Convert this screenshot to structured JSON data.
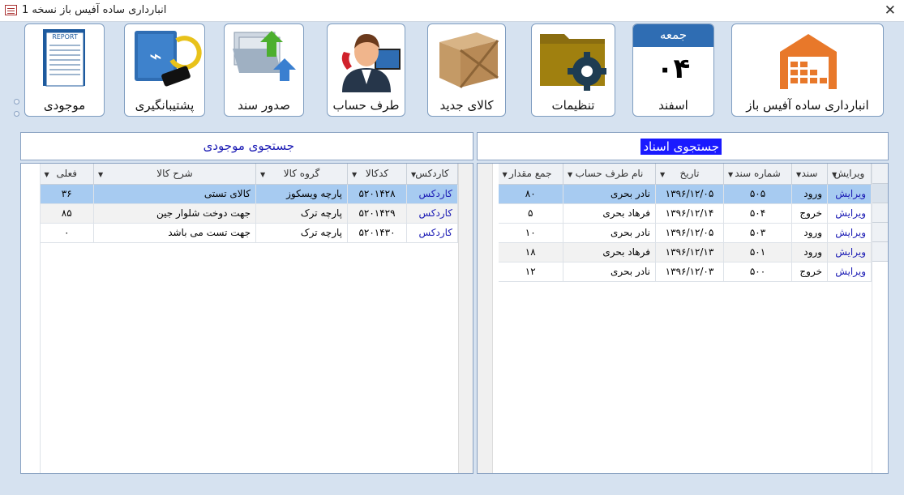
{
  "window": {
    "title": "انبارداری ساده آفیس باز  نسخه 1",
    "close_label": "✕"
  },
  "ribbon": {
    "main_label": "انبارداری ساده آفیس باز",
    "date": {
      "day_name": "جمعه",
      "day": "۰۴",
      "month": "اسفند"
    },
    "settings_label": "تنظیمات",
    "new_item_label": "کالای جدید",
    "account_label": "طرف حساب",
    "issue_doc_label": "صدور سند",
    "backup_label": "پشتیبانگیری",
    "inventory_label": "موجودی",
    "report_icon_text": "REPORT"
  },
  "docs_panel": {
    "title": "جستجوی اسناد",
    "columns": [
      "ویرایش",
      "سند",
      "شماره سند",
      "تاریخ",
      "نام طرف حساب",
      "جمع مقدار"
    ],
    "rows": [
      {
        "edit": "ویرایش",
        "type": "ورود",
        "number": "۵۰۵",
        "date": "۱۳۹۶/۱۲/۰۵",
        "party": "نادر بحری",
        "total": "۸۰"
      },
      {
        "edit": "ویرایش",
        "type": "خروج",
        "number": "۵۰۴",
        "date": "۱۳۹۶/۱۲/۱۴",
        "party": "فرهاد بحری",
        "total": "۵"
      },
      {
        "edit": "ویرایش",
        "type": "ورود",
        "number": "۵۰۳",
        "date": "۱۳۹۶/۱۲/۰۵",
        "party": "نادر بحری",
        "total": "۱۰"
      },
      {
        "edit": "ویرایش",
        "type": "ورود",
        "number": "۵۰۱",
        "date": "۱۳۹۶/۱۲/۱۳",
        "party": "فرهاد بحری",
        "total": "۱۸"
      },
      {
        "edit": "ویرایش",
        "type": "خروج",
        "number": "۵۰۰",
        "date": "۱۳۹۶/۱۲/۰۳",
        "party": "نادر بحری",
        "total": "۱۲"
      }
    ]
  },
  "stock_panel": {
    "title": "جستجوی موجودی",
    "columns": [
      "کاردکس",
      "کدکالا",
      "گروه کالا",
      "شرح کالا",
      "فعلی"
    ],
    "rows": [
      {
        "kardex": "کاردکس",
        "code": "۵۲۰۱۴۲۸",
        "group": "پارچه ویسکوز",
        "desc": "کالای تستی",
        "qty": "۳۶"
      },
      {
        "kardex": "کاردکس",
        "code": "۵۲۰۱۴۲۹",
        "group": "پارچه ترک",
        "desc": "جهت دوخت شلوار جین",
        "qty": "۸۵"
      },
      {
        "kardex": "کاردکس",
        "code": "۵۲۰۱۴۳۰",
        "group": "پارچه ترک",
        "desc": "جهت تست می باشد",
        "qty": "۰"
      }
    ]
  },
  "colors": {
    "link": "#1a1ab4",
    "selected_row": "#a7cbf1",
    "date_header": "#2f6db3",
    "accent_orange": "#e8782a"
  }
}
